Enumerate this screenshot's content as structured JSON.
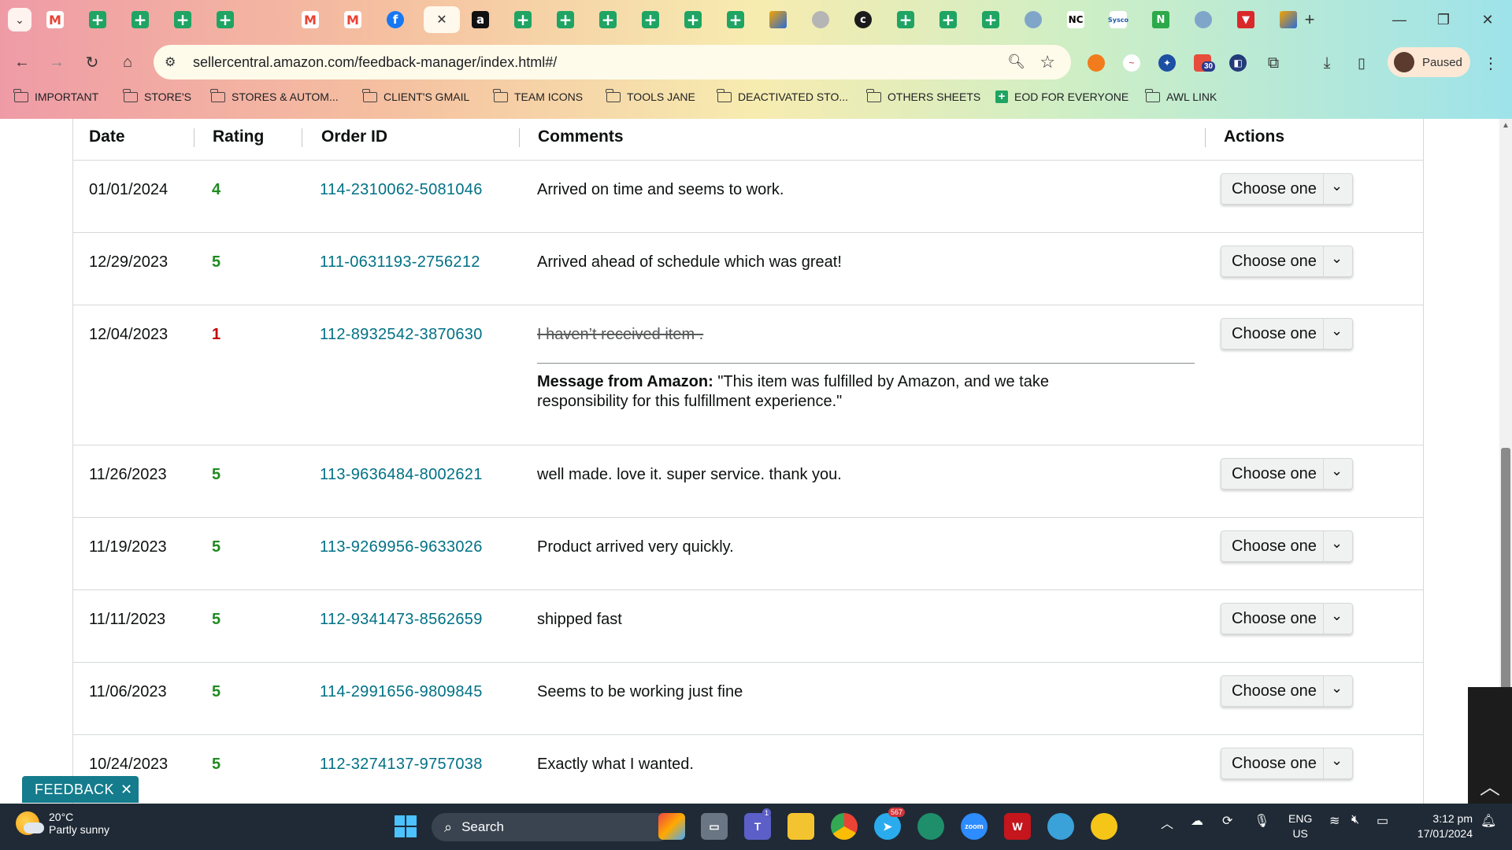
{
  "browser": {
    "url": "sellercentral.amazon.com/feedback-manager/index.html#/",
    "tabs": [
      {
        "icon": "gmail-icon",
        "glyph": "M"
      },
      {
        "icon": "sheets-icon",
        "glyph": ""
      },
      {
        "icon": "sheets-icon",
        "glyph": ""
      },
      {
        "icon": "sheets-icon",
        "glyph": ""
      },
      {
        "icon": "sheets-icon",
        "glyph": ""
      },
      {
        "icon": "google-drive-icon",
        "glyph": ""
      },
      {
        "icon": "gmail-icon",
        "glyph": "M"
      },
      {
        "icon": "gmail-icon",
        "glyph": "M"
      },
      {
        "icon": "facebook-icon",
        "glyph": "f"
      },
      {
        "icon": "close-icon",
        "glyph": "✕"
      },
      {
        "icon": "amazon-icon",
        "glyph": "a"
      },
      {
        "icon": "sheets-icon",
        "glyph": ""
      },
      {
        "icon": "sheets-icon",
        "glyph": ""
      },
      {
        "icon": "sheets-icon",
        "glyph": ""
      },
      {
        "icon": "sheets-icon",
        "glyph": ""
      },
      {
        "icon": "sheets-icon",
        "glyph": ""
      },
      {
        "icon": "sheets-icon",
        "glyph": ""
      },
      {
        "icon": "pencil-app-icon",
        "glyph": ""
      },
      {
        "icon": "globe-icon",
        "glyph": ""
      },
      {
        "icon": "c-logo-icon",
        "glyph": "c"
      },
      {
        "icon": "sheets-icon",
        "glyph": ""
      },
      {
        "icon": "sheets-icon",
        "glyph": ""
      },
      {
        "icon": "sheets-icon",
        "glyph": ""
      },
      {
        "icon": "app-icon",
        "glyph": ""
      },
      {
        "icon": "nc-icon",
        "glyph": "NC"
      },
      {
        "icon": "sysco-icon",
        "glyph": "Sysco"
      },
      {
        "icon": "n-logo-icon",
        "glyph": "N"
      },
      {
        "icon": "app-icon",
        "glyph": ""
      },
      {
        "icon": "shield-icon",
        "glyph": "▼"
      },
      {
        "icon": "pencil-app-icon",
        "glyph": ""
      }
    ],
    "profile_label": "Paused",
    "extension_badge": "30",
    "bookmarks": [
      {
        "label": "IMPORTANT",
        "type": "folder"
      },
      {
        "label": "STORE'S",
        "type": "folder"
      },
      {
        "label": "STORES & AUTOM...",
        "type": "folder"
      },
      {
        "label": "CLIENT'S GMAIL",
        "type": "folder"
      },
      {
        "label": "TEAM ICONS",
        "type": "folder"
      },
      {
        "label": "TOOLS JANE",
        "type": "folder"
      },
      {
        "label": "DEACTIVATED STO...",
        "type": "folder"
      },
      {
        "label": "OTHERS SHEETS",
        "type": "folder"
      },
      {
        "label": "EOD FOR EVERYONE",
        "type": "sheet"
      },
      {
        "label": "AWL LINK",
        "type": "folder"
      }
    ]
  },
  "table": {
    "headers": {
      "date": "Date",
      "rating": "Rating",
      "order_id": "Order ID",
      "comments": "Comments",
      "actions": "Actions"
    },
    "action_label": "Choose one",
    "rows": [
      {
        "date": "01/01/2024",
        "rating": "4",
        "order_id": "114-2310062-5081046",
        "comment": "Arrived on time and seems to work."
      },
      {
        "date": "12/29/2023",
        "rating": "5",
        "order_id": "111-0631193-2756212",
        "comment": "Arrived ahead of schedule which was great!"
      },
      {
        "date": "12/04/2023",
        "rating": "1",
        "order_id": "112-8932542-3870630",
        "comment": "I haven’t received item .",
        "struck": true,
        "amazon_message_label": "Message from Amazon:",
        "amazon_message": "\"This item was fulfilled by Amazon, and we take responsibility for this fulfillment experience.\""
      },
      {
        "date": "11/26/2023",
        "rating": "5",
        "order_id": "113-9636484-8002621",
        "comment": "well made. love it. super service. thank you."
      },
      {
        "date": "11/19/2023",
        "rating": "5",
        "order_id": "113-9269956-9633026",
        "comment": "Product arrived very quickly."
      },
      {
        "date": "11/11/2023",
        "rating": "5",
        "order_id": "112-9341473-8562659",
        "comment": "shipped fast"
      },
      {
        "date": "11/06/2023",
        "rating": "5",
        "order_id": "114-2991656-9809845",
        "comment": "Seems to be working just fine"
      },
      {
        "date": "10/24/2023",
        "rating": "5",
        "order_id": "112-3274137-9757038",
        "comment": "Exactly what I wanted."
      }
    ]
  },
  "feedback_button": {
    "label": "FEEDBACK",
    "close": "✕"
  },
  "taskbar": {
    "weather_temp": "20°C",
    "weather_desc": "Partly sunny",
    "search_label": "Search",
    "telegram_badge": "567",
    "teams_badge": "1",
    "lang_line1": "ENG",
    "lang_line2": "US",
    "time": "3:12 pm",
    "date": "17/01/2024"
  },
  "colors": {
    "link": "#007185",
    "rating_good": "#1f8a1f",
    "rating_bad": "#c40000",
    "feedback_bg": "#147c8c"
  }
}
